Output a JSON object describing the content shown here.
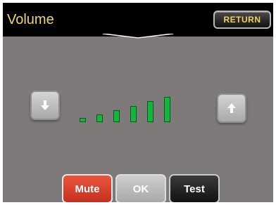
{
  "header": {
    "title": "Volume",
    "return_label": "RETURN"
  },
  "volume": {
    "level": 6,
    "max": 6
  },
  "buttons": {
    "mute": "Mute",
    "ok": "OK",
    "test": "Test"
  },
  "icons": {
    "down": "arrow-down-icon",
    "up": "arrow-up-icon"
  },
  "colors": {
    "title": "#f0d770",
    "return_text": "#f2d35a",
    "bar": "#14b53c",
    "mute": "#d6412c",
    "panel": "#7e7a79"
  }
}
